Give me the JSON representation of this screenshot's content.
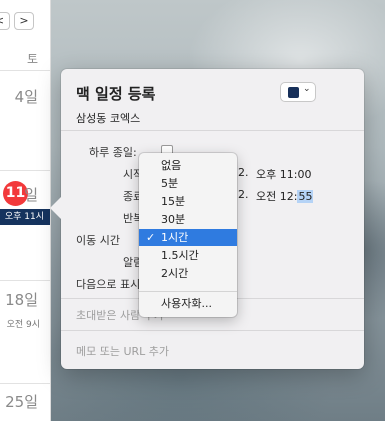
{
  "calendar": {
    "nav_prev": "<",
    "nav_next": ">",
    "weekday": "토",
    "dates": [
      "4일",
      "18일",
      "25일"
    ],
    "today_number": "11",
    "today_suffix": "일",
    "event_time": "오후 11시",
    "event_sub_time": "오전 9시",
    "today_color": "#f2393b",
    "event_color": "#15335e"
  },
  "popover": {
    "title": "맥 일정 등록",
    "location": "삼성동 코엑스",
    "color": "#17305a",
    "labels": {
      "all_day": "하루 종일:",
      "start": "시작",
      "end": "종료",
      "repeat": "반복",
      "travel": "이동 시간",
      "alert": "알림",
      "show_as": "다음으로 표시"
    },
    "start_date_frag": "2.",
    "start_time": "오후 11:00",
    "end_date_frag": "2.",
    "end_time_prefix": "오전 12:",
    "end_time_selected": "55",
    "invitees_placeholder": "초대받은 사람 추가",
    "notes_placeholder": "메모 또는 URL 추가"
  },
  "menu": {
    "items": [
      "없음",
      "5분",
      "15분",
      "30분",
      "1시간",
      "1.5시간",
      "2시간"
    ],
    "selected_index": 4,
    "check_mark": "✓",
    "custom": "사용자화..."
  }
}
